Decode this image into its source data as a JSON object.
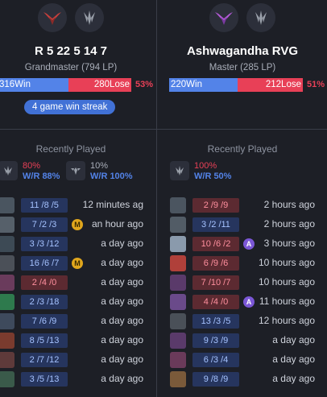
{
  "players": [
    {
      "name": "R 5 22 5 14 7",
      "rank": "Grandmaster (794 LP)",
      "win": "316Win",
      "lose": "280Lose",
      "win_pct": "53%",
      "win_fraction": 0.53,
      "streak": "4 game win streak",
      "recently_played": "Recently Played",
      "emblem_color": "#c7403c",
      "champ_stats": [
        {
          "pct": "80%",
          "wr": "W/R 88%",
          "color": "red"
        },
        {
          "pct": "10%",
          "wr": "W/R 100%",
          "color": "grey"
        }
      ],
      "matches": [
        {
          "kda": "11 /8 /5",
          "result": "win",
          "badge": "",
          "ago": "12 minutes ag",
          "avatar": "#4a5560"
        },
        {
          "kda": "7 /2 /3",
          "result": "win",
          "badge": "M",
          "ago": "an hour ago",
          "avatar": "#56606a"
        },
        {
          "kda": "3 /3 /12",
          "result": "win",
          "badge": "",
          "ago": "a day ago",
          "avatar": "#3d4a55"
        },
        {
          "kda": "16 /6 /7",
          "result": "win",
          "badge": "M",
          "ago": "a day ago",
          "avatar": "#4b5058"
        },
        {
          "kda": "2 /4 /0",
          "result": "loss",
          "badge": "",
          "ago": "a day ago",
          "avatar": "#6a3b5c"
        },
        {
          "kda": "2 /3 /18",
          "result": "win",
          "badge": "",
          "ago": "a day ago",
          "avatar": "#2e7a4d"
        },
        {
          "kda": "7 /6 /9",
          "result": "win",
          "badge": "",
          "ago": "a day ago",
          "avatar": "#3e4a5c"
        },
        {
          "kda": "8 /5 /13",
          "result": "win",
          "badge": "",
          "ago": "a day ago",
          "avatar": "#7a3b2e"
        },
        {
          "kda": "2 /7 /12",
          "result": "win",
          "badge": "",
          "ago": "a day ago",
          "avatar": "#5e3a3a"
        },
        {
          "kda": "3 /5 /13",
          "result": "win",
          "badge": "",
          "ago": "a day ago",
          "avatar": "#3a5a4a"
        }
      ]
    },
    {
      "name": "Ashwagandha RVG",
      "rank": "Master (285 LP)",
      "win": "220Win",
      "lose": "212Lose",
      "win_pct": "51%",
      "win_fraction": 0.51,
      "streak": "",
      "recently_played": "Recently Played",
      "emblem_color": "#b45ad8",
      "champ_stats": [
        {
          "pct": "100%",
          "wr": "W/R 50%",
          "color": "red"
        }
      ],
      "matches": [
        {
          "kda": "2 /9 /9",
          "result": "loss",
          "badge": "",
          "ago": "2 hours ago",
          "avatar": "#4b5560"
        },
        {
          "kda": "3 /2 /11",
          "result": "win",
          "badge": "",
          "ago": "2 hours ago",
          "avatar": "#525c66"
        },
        {
          "kda": "10 /6 /2",
          "result": "loss",
          "badge": "A",
          "ago": "3 hours ago",
          "avatar": "#8a9aac"
        },
        {
          "kda": "6 /9 /6",
          "result": "loss",
          "badge": "",
          "ago": "10 hours ago",
          "avatar": "#b0403a"
        },
        {
          "kda": "7 /10 /7",
          "result": "loss",
          "badge": "",
          "ago": "10 hours ago",
          "avatar": "#5a3a6a"
        },
        {
          "kda": "4 /4 /0",
          "result": "loss",
          "badge": "A",
          "ago": "11 hours ago",
          "avatar": "#6a4a8a"
        },
        {
          "kda": "13 /3 /5",
          "result": "win",
          "badge": "",
          "ago": "12 hours ago",
          "avatar": "#4a5058"
        },
        {
          "kda": "9 /3 /9",
          "result": "win",
          "badge": "",
          "ago": "a day ago",
          "avatar": "#5a3a6a"
        },
        {
          "kda": "6 /3 /4",
          "result": "win",
          "badge": "",
          "ago": "a day ago",
          "avatar": "#6a3a5a"
        },
        {
          "kda": "9 /8 /9",
          "result": "win",
          "badge": "",
          "ago": "a day ago",
          "avatar": "#7a5a3a"
        }
      ]
    }
  ]
}
